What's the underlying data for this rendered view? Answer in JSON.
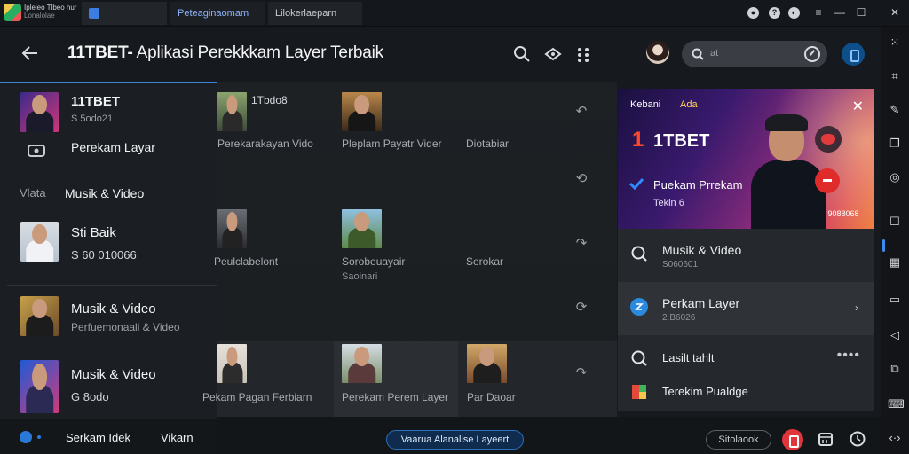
{
  "titlebar": {
    "app_name_line1": "Ipleleo Tlbeo hur",
    "app_name_line2": "Lonalolae",
    "tabs": [
      "Peteaginaomam",
      "Lilokerlaeparn"
    ]
  },
  "header": {
    "brand": "11TBET-",
    "title_rest": " Aplikasi Perekkkam Layer Terbaik",
    "search_value": "at"
  },
  "drawer": {
    "items": [
      {
        "title": "11TBET",
        "sub": "S 5odo21"
      },
      {
        "title": "Perekam Layar",
        "sub": ""
      },
      {
        "title": "Musik & Video",
        "sub": ""
      },
      {
        "title": "Sti Baik",
        "sub": "S 60 010066"
      },
      {
        "title": "Musik & Video",
        "sub": "Perfuemonaali & Video"
      },
      {
        "title": "Musik & Video",
        "sub": "G 8odo"
      }
    ],
    "section_left": "Vlata",
    "bottom_items": [
      "Serkam Idek",
      "Vikarn"
    ]
  },
  "grid": {
    "cells": [
      {
        "top": "1Tbdo8",
        "label": "Perekarakayan Vido",
        "label2": ""
      },
      {
        "top": "",
        "label": "Pleplam Payatr Vider",
        "label2": ""
      },
      {
        "top": "",
        "label": "Diotabiar",
        "label2": ""
      },
      {
        "top": "",
        "label": "Peulclabelont",
        "label2": ""
      },
      {
        "top": "",
        "label": "Sorobeuayair",
        "label2": "Saoinari"
      },
      {
        "top": "",
        "label": "Serokar",
        "label2": ""
      },
      {
        "top": "",
        "label": "Pekam Pagan Ferbiarn",
        "label2": ""
      },
      {
        "top": "",
        "label": "Perekam Perem Layer",
        "label2": ""
      },
      {
        "top": "",
        "label": "Par Daoar",
        "label2": ""
      }
    ]
  },
  "panel": {
    "banner": {
      "kicker_left": "Kebani",
      "kicker_right": "Ada",
      "number": "1",
      "brand": "1TBET",
      "line1": "Puekam Prrekam",
      "line2": "Tekin 6",
      "tag": "S 9088068"
    },
    "rows": [
      {
        "title": "Musik & Video",
        "sub": "S060601"
      },
      {
        "title": "Perkam Layer",
        "sub": "2.B6026"
      }
    ],
    "rows2": [
      {
        "title": "Lasilt tahlt"
      },
      {
        "title": "Terekim Pualdge"
      }
    ]
  },
  "bottombar": {
    "center_pill": "Vaarua Alanalise Layeert",
    "right_pill": "Sitolaook"
  },
  "colors": {
    "accent_blue": "#3e87d6",
    "record_red": "#e0353b",
    "brand_orange": "#ff4a2a"
  }
}
